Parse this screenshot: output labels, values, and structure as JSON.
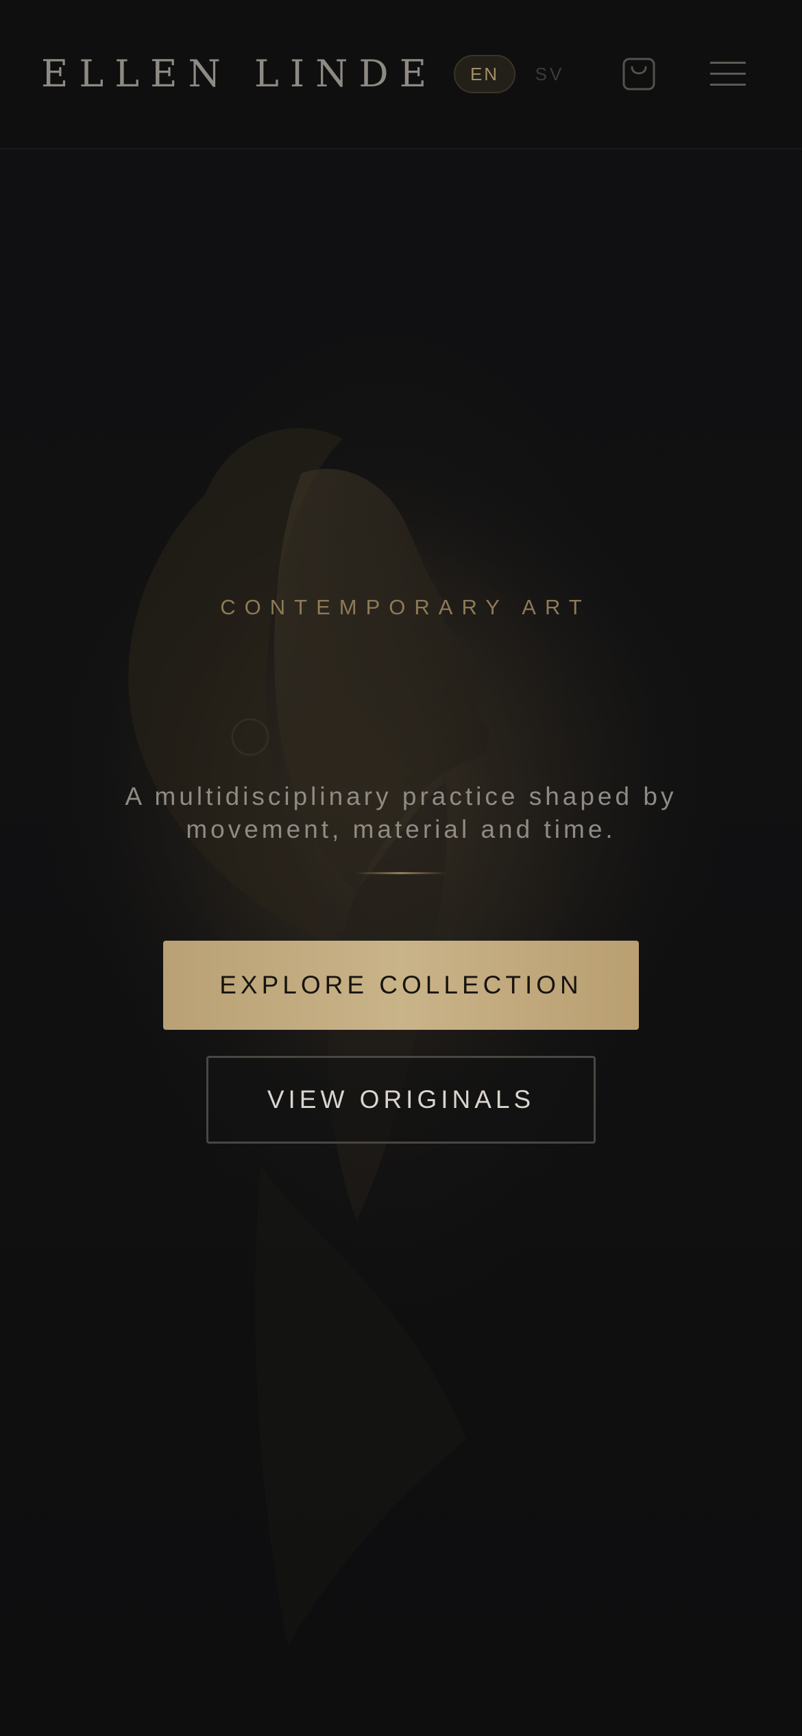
{
  "header": {
    "brand": "ELLEN LINDE",
    "languages": [
      {
        "code": "EN",
        "active": true
      },
      {
        "code": "SV",
        "active": false
      }
    ],
    "cart_icon": "shopping-bag-icon",
    "menu_icon": "hamburger-menu-icon"
  },
  "hero": {
    "eyebrow": "CONTEMPORARY ART",
    "lead_line1": "A multidisciplinary practice shaped by",
    "lead_line2": "movement, material and time.",
    "primary_button": "EXPLORE COLLECTION",
    "secondary_button": "VIEW ORIGINALS"
  },
  "colors": {
    "background": "#0d0d0e",
    "accent_gold": "#c4ad82",
    "eyebrow_gold": "#8e7a58",
    "text_muted": "#8f8b85"
  }
}
